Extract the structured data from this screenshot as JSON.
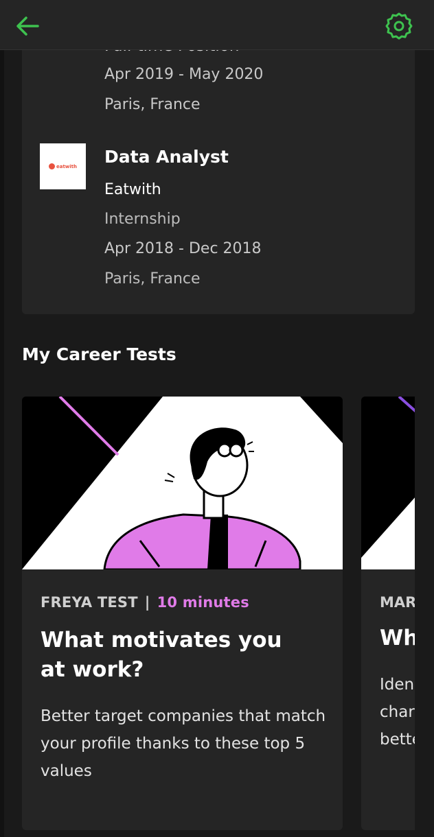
{
  "header": {
    "back_icon": "arrow-left-icon",
    "settings_icon": "gear-icon",
    "accent_color": "#3ec24f"
  },
  "experience": {
    "previous_title_partial": "Full-time Position",
    "previous_dates": "Apr 2019 - May 2020",
    "previous_location": "Paris, France",
    "current": {
      "title": "Data Analyst",
      "company": "Eatwith",
      "logo_text": "eatwith",
      "type": "Internship",
      "dates": "Apr 2018 - Dec 2018",
      "location": "Paris, France"
    }
  },
  "career_tests": {
    "section_title": "My Career Tests",
    "cards": [
      {
        "brand": "FREYA TEST",
        "separator": "|",
        "duration": "10 minutes",
        "title": "What motivates you at work?",
        "description": "Better target companies that match your profile thanks to these top 5 values"
      }
    ],
    "peek_card": {
      "brand_partial": "MAR",
      "title_partial": "Wh",
      "desc_line1": "Iden",
      "desc_line2": "char",
      "desc_line3": "bette"
    }
  },
  "colors": {
    "duration_pink": "#e07be8",
    "illustration_purple": "#e07be8"
  }
}
